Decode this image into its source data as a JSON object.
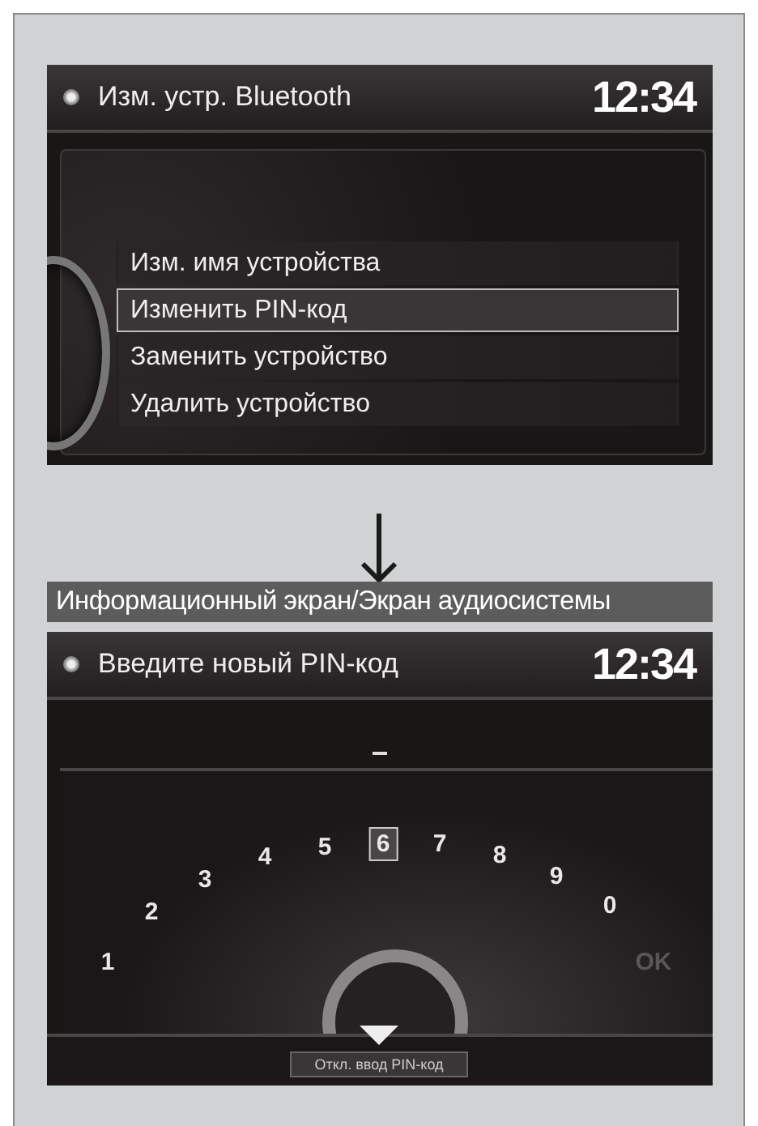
{
  "screens": [
    {
      "kind": "menu",
      "title": "Изм. устр. Bluetooth",
      "clock": "12:34",
      "items": [
        {
          "label": "Изм. имя устройства",
          "selected": false
        },
        {
          "label": "Изменить PIN-код",
          "selected": true
        },
        {
          "label": "Заменить устройство",
          "selected": false
        },
        {
          "label": "Удалить устройство",
          "selected": false
        }
      ]
    },
    {
      "kind": "caption",
      "label": "Информационный экран/Экран аудиосистемы"
    },
    {
      "kind": "keypad",
      "title": "Введите новый PIN-код",
      "clock": "12:34",
      "keys": [
        {
          "label": "1",
          "selected": false,
          "disabled": false
        },
        {
          "label": "2",
          "selected": false,
          "disabled": false
        },
        {
          "label": "3",
          "selected": false,
          "disabled": false
        },
        {
          "label": "4",
          "selected": false,
          "disabled": false
        },
        {
          "label": "5",
          "selected": false,
          "disabled": false
        },
        {
          "label": "6",
          "selected": true,
          "disabled": false
        },
        {
          "label": "7",
          "selected": false,
          "disabled": false
        },
        {
          "label": "8",
          "selected": false,
          "disabled": false
        },
        {
          "label": "9",
          "selected": false,
          "disabled": false
        },
        {
          "label": "0",
          "selected": false,
          "disabled": false
        },
        {
          "label": "OK",
          "selected": false,
          "disabled": true
        }
      ],
      "bottom_button": "Откл. ввод PIN-код"
    }
  ]
}
